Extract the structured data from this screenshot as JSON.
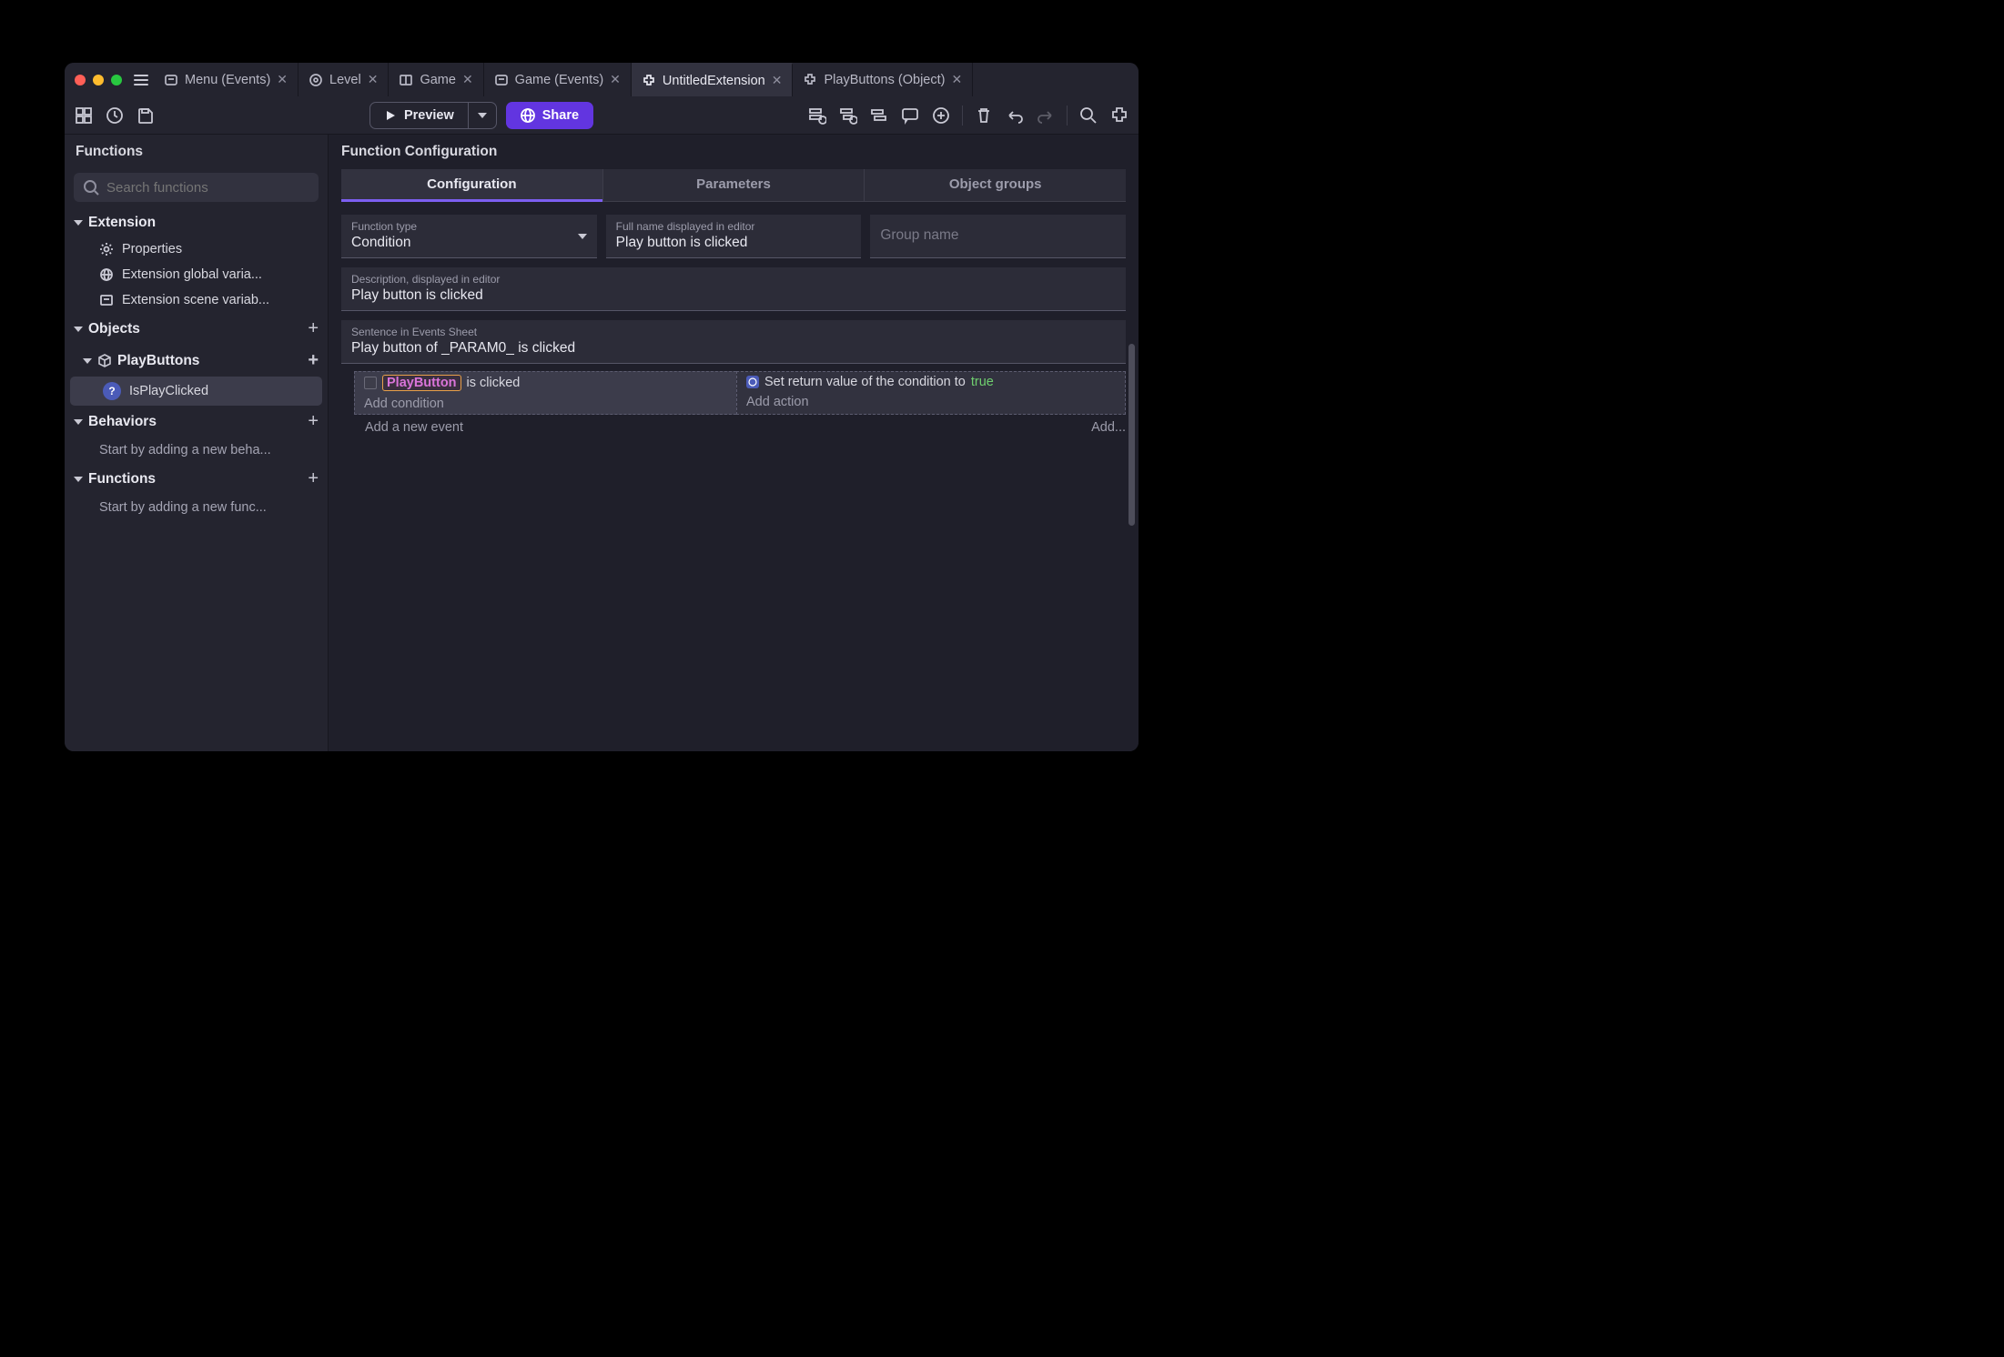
{
  "tabs": [
    {
      "label": "Menu (Events)"
    },
    {
      "label": "Level"
    },
    {
      "label": "Game"
    },
    {
      "label": "Game (Events)"
    },
    {
      "label": "UntitledExtension"
    },
    {
      "label": "PlayButtons (Object)"
    }
  ],
  "toolbar": {
    "preview": "Preview",
    "share": "Share"
  },
  "sidebar": {
    "title": "Functions",
    "search_placeholder": "Search functions",
    "extension": {
      "label": "Extension",
      "properties": "Properties",
      "global_vars": "Extension global varia...",
      "scene_vars": "Extension scene variab..."
    },
    "objects": {
      "label": "Objects",
      "play_buttons": "PlayButtons",
      "is_play_clicked": "IsPlayClicked"
    },
    "behaviors": {
      "label": "Behaviors",
      "empty": "Start by adding a new beha..."
    },
    "functions": {
      "label": "Functions",
      "empty": "Start by adding a new func..."
    }
  },
  "content": {
    "title": "Function Configuration",
    "tabs": {
      "config": "Configuration",
      "params": "Parameters",
      "groups": "Object groups"
    },
    "fields": {
      "type_label": "Function type",
      "type_value": "Condition",
      "name_label": "Full name displayed in editor",
      "name_value": "Play button is clicked",
      "group_placeholder": "Group name",
      "desc_label": "Description, displayed in editor",
      "desc_value": "Play button is clicked",
      "sentence_label": "Sentence in Events Sheet",
      "sentence_value": "Play button of _PARAM0_ is clicked"
    },
    "events": {
      "cond_object": "PlayButton",
      "cond_suffix": "is clicked",
      "add_condition": "Add condition",
      "action_text": "Set return value of the condition to",
      "action_true": "true",
      "add_action": "Add action",
      "add_event": "Add a new event",
      "add_right": "Add..."
    }
  }
}
